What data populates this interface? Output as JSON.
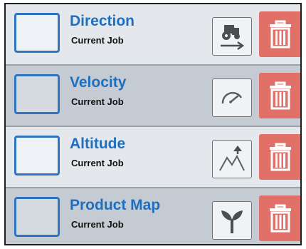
{
  "items": [
    {
      "title": "Direction",
      "subtitle": "Current Job",
      "icon": "tractor-direction-icon"
    },
    {
      "title": "Velocity",
      "subtitle": "Current Job",
      "icon": "speedometer-icon"
    },
    {
      "title": "Altitude",
      "subtitle": "Current Job",
      "icon": "mountain-altitude-icon"
    },
    {
      "title": "Product Map",
      "subtitle": "Current Job",
      "icon": "plant-sprout-icon"
    }
  ],
  "colors": {
    "title": "#1f6fc0",
    "checkbox_border": "#2f74c0",
    "delete": "#e07068",
    "row_light": "#e4e7ec",
    "row_dark": "#c5cbd2"
  }
}
